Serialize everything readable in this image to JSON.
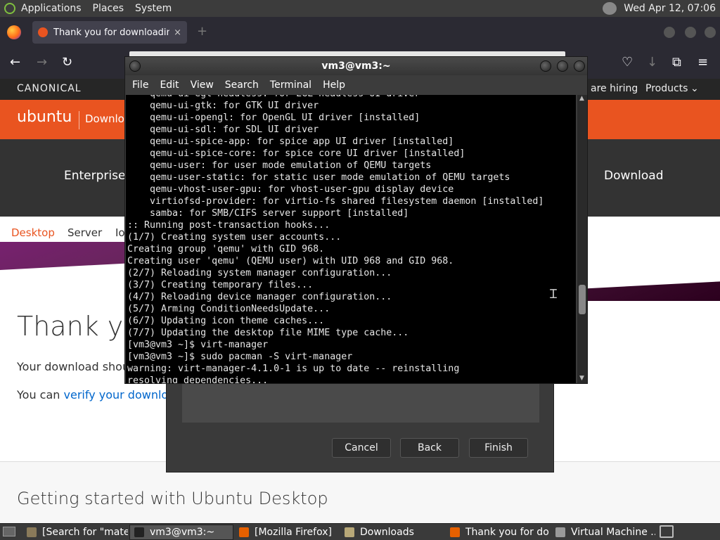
{
  "top_panel": {
    "menus": [
      "Applications",
      "Places",
      "System"
    ],
    "clock": "Wed Apr 12, 07:06"
  },
  "firefox": {
    "tab_title": "Thank you for downloading U",
    "tab_close": "×",
    "new_tab": "+"
  },
  "page": {
    "canonical": "CANONICAL",
    "hiring": "are hiring",
    "products": "Products",
    "ubuntu": "ubuntu",
    "ubuntu_sub": "Downlo",
    "nav_left": "Enterprise",
    "nav_right": "Download",
    "subnav": [
      "Desktop",
      "Server",
      "Io"
    ],
    "heading": "Thank you",
    "download_text": "Your download should",
    "verify_text": "You can ",
    "verify_link": "verify your download",
    "getting_started": "Getting started with Ubuntu Desktop"
  },
  "vm_dialog": {
    "buttons": [
      "Cancel",
      "Back",
      "Finish"
    ]
  },
  "terminal": {
    "title": "vm3@vm3:~",
    "menu": [
      "File",
      "Edit",
      "View",
      "Search",
      "Terminal",
      "Help"
    ],
    "lines": [
      "    qemu-ui-egl-headless: for EGL headless UI driver",
      "    qemu-ui-gtk: for GTK UI driver",
      "    qemu-ui-opengl: for OpenGL UI driver [installed]",
      "    qemu-ui-sdl: for SDL UI driver",
      "    qemu-ui-spice-app: for spice app UI driver [installed]",
      "    qemu-ui-spice-core: for spice core UI driver [installed]",
      "    qemu-user: for user mode emulation of QEMU targets",
      "    qemu-user-static: for static user mode emulation of QEMU targets",
      "    qemu-vhost-user-gpu: for vhost-user-gpu display device",
      "    virtiofsd-provider: for virtio-fs shared filesystem daemon [installed]",
      "    samba: for SMB/CIFS server support [installed]",
      ":: Running post-transaction hooks...",
      "(1/7) Creating system user accounts...",
      "Creating group 'qemu' with GID 968.",
      "Creating user 'qemu' (QEMU user) with UID 968 and GID 968.",
      "(2/7) Reloading system manager configuration...",
      "(3/7) Creating temporary files...",
      "(4/7) Reloading device manager configuration...",
      "(5/7) Arming ConditionNeedsUpdate...",
      "(6/7) Updating icon theme caches...",
      "(7/7) Updating the desktop file MIME type cache...",
      "[vm3@vm3 ~]$ virt-manager",
      "[vm3@vm3 ~]$ sudo pacman -S virt-manager",
      "warning: virt-manager-4.1.0-1 is up to date -- reinstalling",
      "resolving dependencies..."
    ]
  },
  "taskbar": {
    "items": [
      {
        "label": "[Search for \"mate...",
        "icon": "search-icon",
        "color": "#8a7a5a"
      },
      {
        "label": "vm3@vm3:~",
        "icon": "terminal-icon",
        "color": "#222222"
      },
      {
        "label": "[Mozilla Firefox]",
        "icon": "firefox-icon",
        "color": "#e66000"
      },
      {
        "label": "Downloads",
        "icon": "folder-icon",
        "color": "#b8a878"
      },
      {
        "label": "Thank you for do...",
        "icon": "firefox-icon",
        "color": "#e66000"
      },
      {
        "label": "Virtual Machine ...",
        "icon": "vm-icon",
        "color": "#999999"
      }
    ]
  },
  "colors": {
    "ubuntu_orange": "#e95420",
    "terminal_bg": "#000000",
    "panel_bg": "#3c3c3c"
  }
}
